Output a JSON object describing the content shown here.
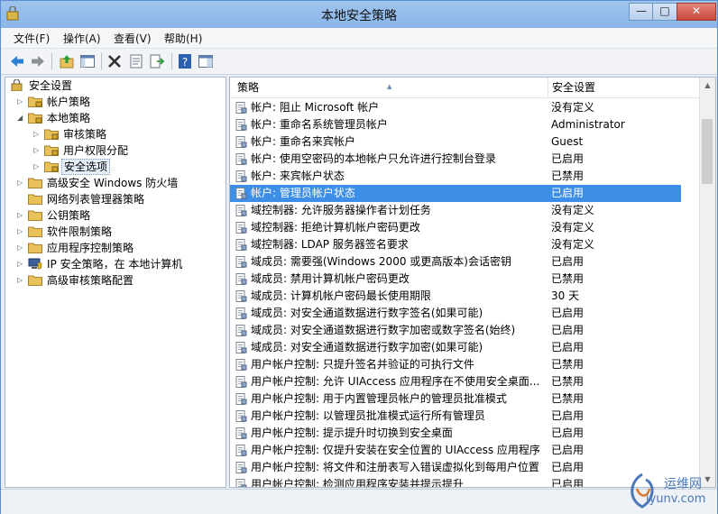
{
  "window": {
    "title": "本地安全策略"
  },
  "window_controls": {
    "minimize": "—",
    "maximize": "□",
    "close": "✕"
  },
  "menu": [
    "文件(F)",
    "操作(A)",
    "查看(V)",
    "帮助(H)"
  ],
  "toolbar": {
    "icons": [
      "back-icon",
      "forward-icon",
      "up-folder-icon",
      "show-hide-tree-icon",
      "delete-icon",
      "properties-icon",
      "export-list-icon",
      "help-icon",
      "panel-icon"
    ]
  },
  "tree": [
    {
      "label": "安全设置",
      "level": 0,
      "expander": "none",
      "icon": "root"
    },
    {
      "label": "帐户策略",
      "level": 1,
      "expander": "collapsed",
      "icon": "folder"
    },
    {
      "label": "本地策略",
      "level": 1,
      "expander": "expanded",
      "icon": "folder"
    },
    {
      "label": "审核策略",
      "level": 2,
      "expander": "collapsed",
      "icon": "folder"
    },
    {
      "label": "用户权限分配",
      "level": 2,
      "expander": "collapsed",
      "icon": "folder"
    },
    {
      "label": "安全选项",
      "level": 2,
      "expander": "collapsed",
      "icon": "folder",
      "selected": true
    },
    {
      "label": "高级安全 Windows 防火墙",
      "level": 1,
      "expander": "collapsed",
      "icon": "folder"
    },
    {
      "label": "网络列表管理器策略",
      "level": 1,
      "expander": "none",
      "icon": "folder"
    },
    {
      "label": "公钥策略",
      "level": 1,
      "expander": "collapsed",
      "icon": "folder"
    },
    {
      "label": "软件限制策略",
      "level": 1,
      "expander": "collapsed",
      "icon": "folder"
    },
    {
      "label": "应用程序控制策略",
      "level": 1,
      "expander": "collapsed",
      "icon": "folder"
    },
    {
      "label": "IP 安全策略，在 本地计算机",
      "level": 1,
      "expander": "collapsed",
      "icon": "computer"
    },
    {
      "label": "高级审核策略配置",
      "level": 1,
      "expander": "collapsed",
      "icon": "folder"
    }
  ],
  "columns": {
    "policy": "策略",
    "setting": "安全设置"
  },
  "policies": [
    {
      "policy": "帐户: 阻止 Microsoft 帐户",
      "setting": "没有定义"
    },
    {
      "policy": "帐户: 重命名系统管理员帐户",
      "setting": "Administrator"
    },
    {
      "policy": "帐户: 重命名来宾帐户",
      "setting": "Guest"
    },
    {
      "policy": "帐户: 使用空密码的本地帐户只允许进行控制台登录",
      "setting": "已启用"
    },
    {
      "policy": "帐户: 来宾帐户状态",
      "setting": "已禁用"
    },
    {
      "policy": "帐户: 管理员帐户状态",
      "setting": "已启用",
      "selected": true
    },
    {
      "policy": "域控制器: 允许服务器操作者计划任务",
      "setting": "没有定义"
    },
    {
      "policy": "域控制器: 拒绝计算机帐户密码更改",
      "setting": "没有定义"
    },
    {
      "policy": "域控制器: LDAP 服务器签名要求",
      "setting": "没有定义"
    },
    {
      "policy": "域成员: 需要强(Windows 2000 或更高版本)会话密钥",
      "setting": "已启用"
    },
    {
      "policy": "域成员: 禁用计算机帐户密码更改",
      "setting": "已禁用"
    },
    {
      "policy": "域成员: 计算机帐户密码最长使用期限",
      "setting": "30 天"
    },
    {
      "policy": "域成员: 对安全通道数据进行数字签名(如果可能)",
      "setting": "已启用"
    },
    {
      "policy": "域成员: 对安全通道数据进行数字加密或数字签名(始终)",
      "setting": "已启用"
    },
    {
      "policy": "域成员: 对安全通道数据进行数字加密(如果可能)",
      "setting": "已启用"
    },
    {
      "policy": "用户帐户控制: 只提升签名并验证的可执行文件",
      "setting": "已禁用"
    },
    {
      "policy": "用户帐户控制: 允许 UIAccess 应用程序在不使用安全桌面...",
      "setting": "已禁用"
    },
    {
      "policy": "用户帐户控制: 用于内置管理员帐户的管理员批准模式",
      "setting": "已禁用"
    },
    {
      "policy": "用户帐户控制: 以管理员批准模式运行所有管理员",
      "setting": "已启用"
    },
    {
      "policy": "用户帐户控制: 提示提升时切换到安全桌面",
      "setting": "已启用"
    },
    {
      "policy": "用户帐户控制: 仅提升安装在安全位置的 UIAccess 应用程序",
      "setting": "已启用"
    },
    {
      "policy": "用户帐户控制: 将文件和注册表写入错误虚拟化到每用户位置",
      "setting": "已启用"
    },
    {
      "policy": "用户帐户控制: 检测应用程序安装并提示提升",
      "setting": "已启用"
    }
  ],
  "watermark": {
    "line1": "运维网",
    "line2": "iyunv.com"
  },
  "colors": {
    "selection": "#3c8ee6",
    "titlebar": "#8ab6e8",
    "folder": "#e8c15a"
  }
}
